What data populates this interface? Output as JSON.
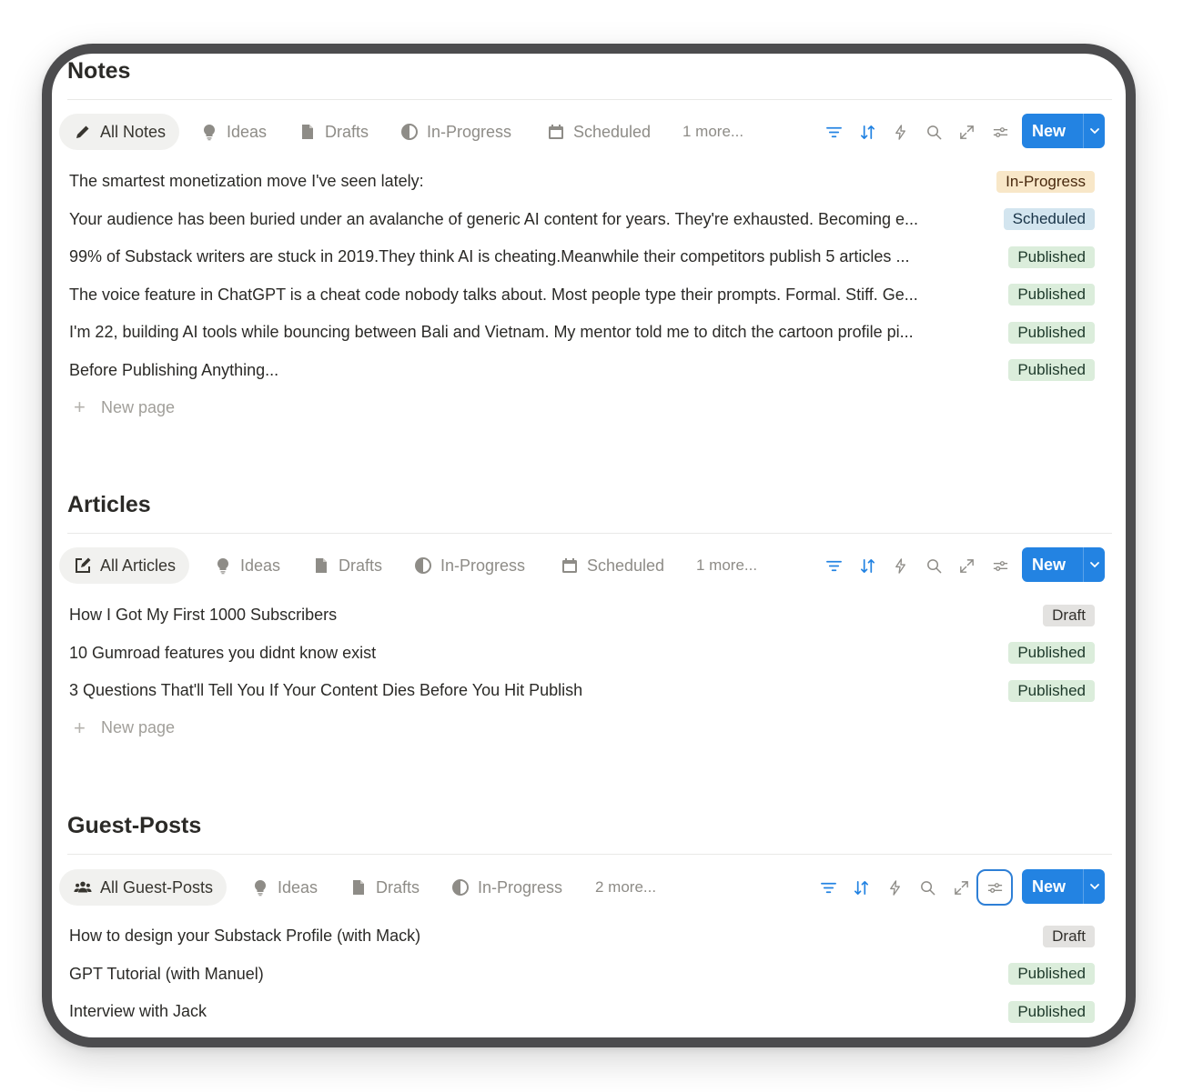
{
  "sections": [
    {
      "title": "Notes",
      "tabs": [
        {
          "label": "All Notes",
          "icon": "pencil-icon"
        },
        {
          "label": "Ideas",
          "icon": "lightbulb-icon"
        },
        {
          "label": "Drafts",
          "icon": "document-icon"
        },
        {
          "label": "In-Progress",
          "icon": "half-circle-icon"
        },
        {
          "label": "Scheduled",
          "icon": "calendar-icon"
        }
      ],
      "more_label": "1 more...",
      "new_label": "New",
      "rows": [
        {
          "title": "The smartest monetization move I've seen lately:",
          "status": "In-Progress"
        },
        {
          "title": "Your audience has been buried under an avalanche of generic AI content for years. They're exhausted. Becoming e...",
          "status": "Scheduled"
        },
        {
          "title": "99% of Substack writers are stuck in 2019.They think AI is cheating.Meanwhile their competitors publish 5 articles ...",
          "status": "Published"
        },
        {
          "title": "The voice feature in ChatGPT is a cheat code nobody talks about. Most people type their prompts. Formal. Stiff. Ge...",
          "status": "Published"
        },
        {
          "title": "I'm 22, building AI tools while bouncing between Bali and Vietnam. My mentor told me to ditch the cartoon profile pi...",
          "status": "Published"
        },
        {
          "title": "Before Publishing Anything...",
          "status": "Published"
        }
      ],
      "new_page_label": "New page"
    },
    {
      "title": "Articles",
      "tabs": [
        {
          "label": "All Articles",
          "icon": "edit-square-icon"
        },
        {
          "label": "Ideas",
          "icon": "lightbulb-icon"
        },
        {
          "label": "Drafts",
          "icon": "document-icon"
        },
        {
          "label": "In-Progress",
          "icon": "half-circle-icon"
        },
        {
          "label": "Scheduled",
          "icon": "calendar-icon"
        }
      ],
      "more_label": "1 more...",
      "new_label": "New",
      "rows": [
        {
          "title": "How I Got My First 1000 Subscribers",
          "status": "Draft"
        },
        {
          "title": "10 Gumroad features you didnt know exist",
          "status": "Published"
        },
        {
          "title": "3 Questions That'll Tell You If Your Content Dies Before You Hit Publish",
          "status": "Published"
        }
      ],
      "new_page_label": "New page"
    },
    {
      "title": "Guest-Posts",
      "tabs": [
        {
          "label": "All Guest-Posts",
          "icon": "people-icon"
        },
        {
          "label": "Ideas",
          "icon": "lightbulb-icon"
        },
        {
          "label": "Drafts",
          "icon": "document-icon"
        },
        {
          "label": "In-Progress",
          "icon": "half-circle-icon"
        }
      ],
      "more_label": "2 more...",
      "new_label": "New",
      "rows": [
        {
          "title": "How to design your Substack Profile (with Mack)",
          "status": "Draft"
        },
        {
          "title": "GPT Tutorial (with Manuel)",
          "status": "Published"
        },
        {
          "title": "Interview with Jack",
          "status": "Published"
        }
      ]
    }
  ],
  "toolbar_icons": [
    "filter-icon",
    "sort-icon",
    "lightning-icon",
    "search-icon",
    "expand-icon",
    "settings-sliders-icon"
  ],
  "colors": {
    "accent": "#2383e2",
    "published": "#dbeddb",
    "draft": "#e3e2e0",
    "in_progress": "#f8e7c8",
    "scheduled": "#d3e5ef"
  }
}
